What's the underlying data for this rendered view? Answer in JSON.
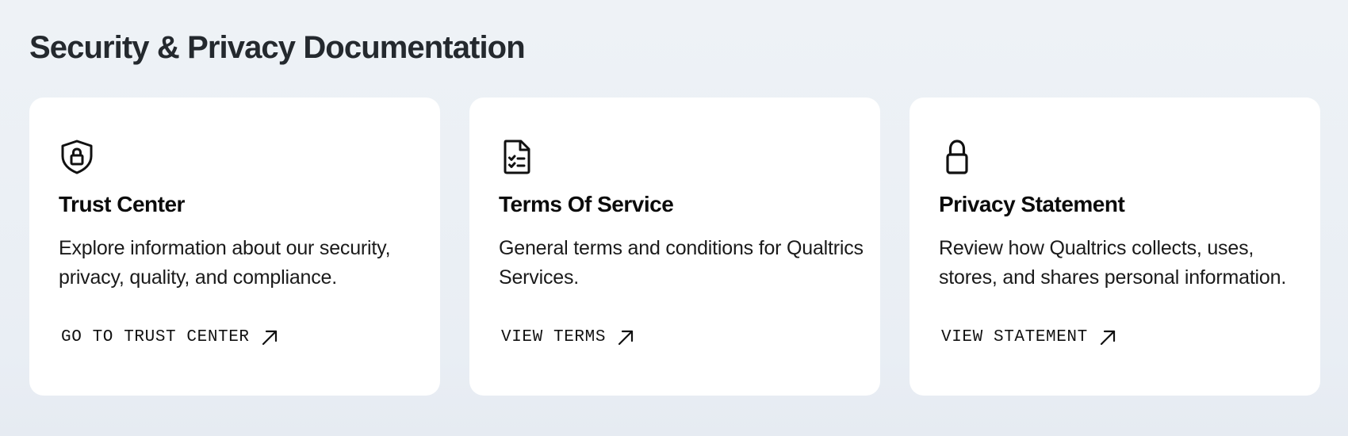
{
  "section": {
    "title": "Security & Privacy Documentation"
  },
  "cards": [
    {
      "icon": "shield-lock-icon",
      "title": "Trust Center",
      "description": "Explore information about our security, privacy, quality, and compliance.",
      "link_label": "GO TO TRUST CENTER",
      "link_icon": "arrow-up-right-icon"
    },
    {
      "icon": "document-checklist-icon",
      "title": "Terms Of Service",
      "description": "General terms and conditions for Qualtrics Services.",
      "link_label": "VIEW TERMS",
      "link_icon": "arrow-up-right-icon"
    },
    {
      "icon": "padlock-icon",
      "title": "Privacy Statement",
      "description": "Review how Qualtrics collects, uses, stores, and shares personal information.",
      "link_label": "VIEW STATEMENT",
      "link_icon": "arrow-up-right-icon"
    }
  ],
  "colors": {
    "background": "#eef2f6",
    "card": "#ffffff",
    "text": "#1f2328"
  }
}
